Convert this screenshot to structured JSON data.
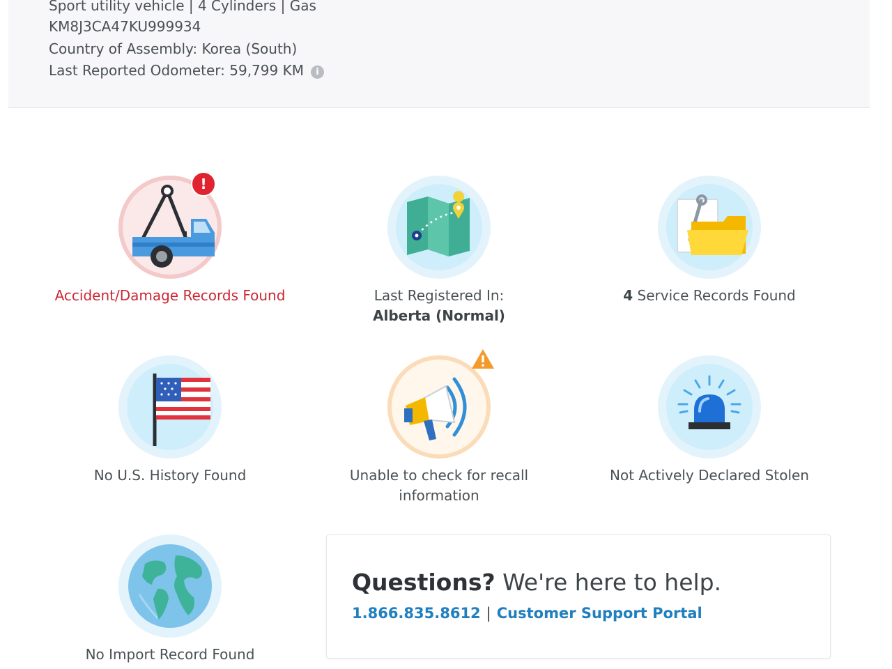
{
  "vehicle": {
    "spec": "Sport utility vehicle | 4 Cylinders | Gas",
    "vin": "KM8J3CA47KU999934",
    "assembly": "Country of Assembly: Korea (South)",
    "odometer": "Last Reported Odometer: 59,799 KM",
    "info_icon": "info-icon"
  },
  "tiles": {
    "accident": {
      "label": "Accident/Damage Records Found",
      "icon": "tow-truck-icon",
      "badge": "!"
    },
    "registered": {
      "label_prefix": "Last Registered In:",
      "label_value": "Alberta (Normal)",
      "icon": "map-icon"
    },
    "service": {
      "count": "4",
      "label_suffix": " Service Records Found",
      "icon": "folder-wrench-icon"
    },
    "us_history": {
      "label": "No U.S. History Found",
      "icon": "us-flag-icon"
    },
    "recall": {
      "label": "Unable to check for recall information",
      "icon": "megaphone-icon",
      "badge": "!"
    },
    "stolen": {
      "label": "Not Actively Declared Stolen",
      "icon": "siren-icon"
    },
    "import": {
      "label": "No Import Record Found",
      "icon": "globe-icon"
    }
  },
  "help": {
    "title": "Questions?",
    "subtitle": " We're here to help.",
    "phone": "1.866.835.8612",
    "separator": "|",
    "portal": "Customer Support Portal"
  },
  "colors": {
    "danger": "#cc2632",
    "link": "#1f7fbf",
    "warning": "#f39a2b",
    "halo_blue": "#e3f3fc"
  }
}
